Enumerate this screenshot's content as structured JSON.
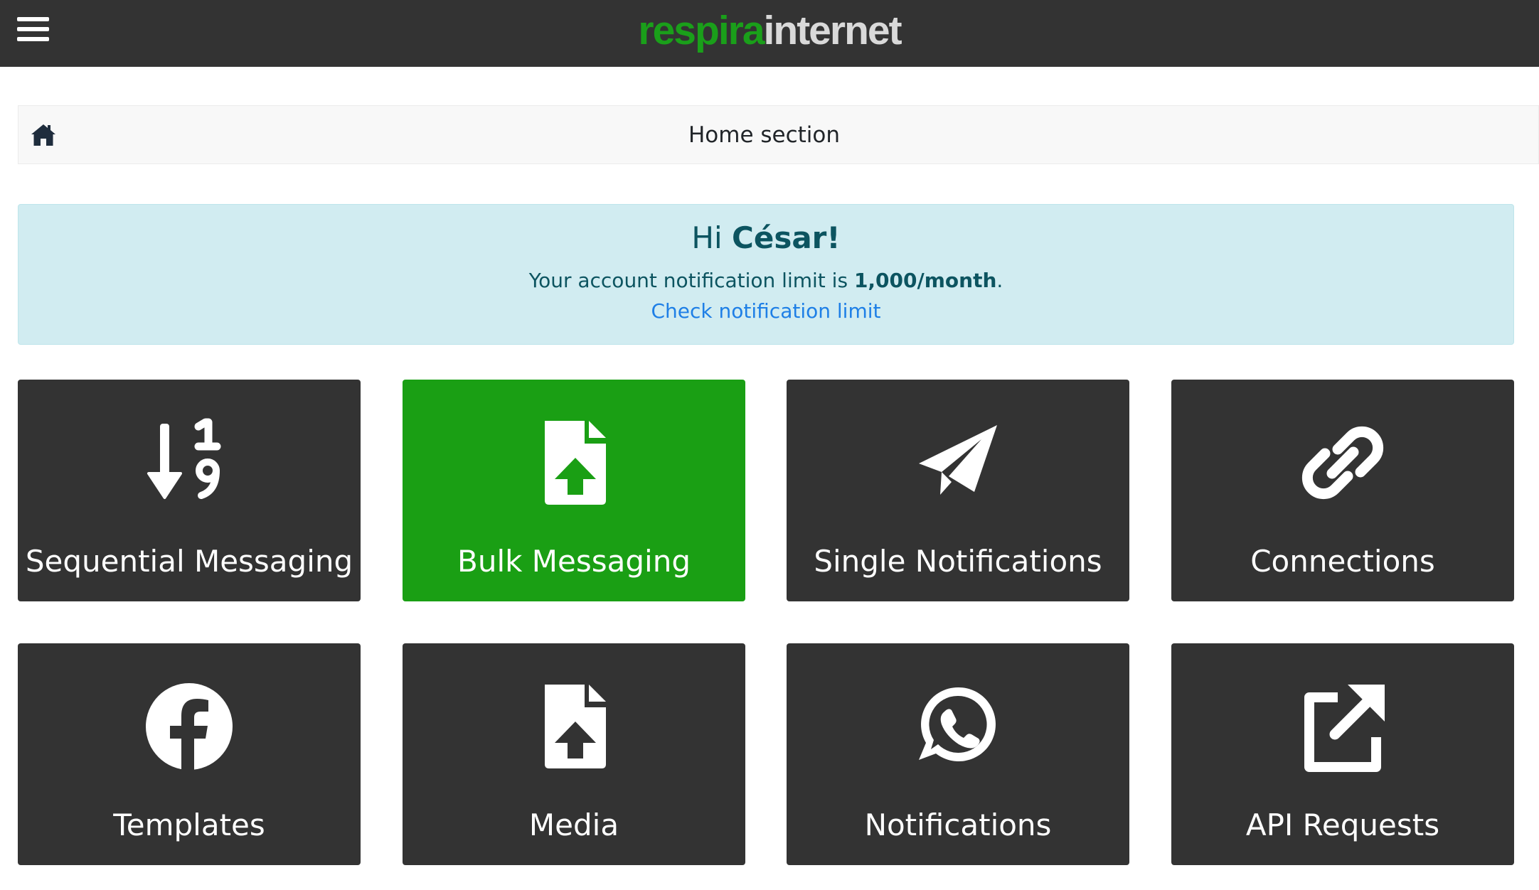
{
  "brand": {
    "name_part1": "respira",
    "name_part2": "internet",
    "colors": {
      "primary": "#1a9f14",
      "topbar": "#333333",
      "tile": "#333333",
      "alert_bg": "#d1ecf1",
      "link": "#1e7fe6"
    }
  },
  "header": {
    "menu_icon": "hamburger-icon"
  },
  "breadcrumb": {
    "home_icon": "home-icon",
    "title": "Home section"
  },
  "alert": {
    "greeting_prefix": "Hi ",
    "user_name": "César!",
    "limit_prefix": "Your account notification limit is ",
    "limit_value": "1,000/month",
    "limit_suffix": ".",
    "link_text": "Check notification limit"
  },
  "tiles": [
    {
      "label": "Sequential Messaging",
      "icon": "sort-numeric-down-icon",
      "active": false
    },
    {
      "label": "Bulk Messaging",
      "icon": "file-upload-icon",
      "active": true
    },
    {
      "label": "Single Notifications",
      "icon": "paper-plane-icon",
      "active": false
    },
    {
      "label": "Connections",
      "icon": "link-icon",
      "active": false
    },
    {
      "label": "Templates",
      "icon": "facebook-icon",
      "active": false
    },
    {
      "label": "Media",
      "icon": "file-upload-icon",
      "active": false
    },
    {
      "label": "Notifications",
      "icon": "whatsapp-icon",
      "active": false
    },
    {
      "label": "API Requests",
      "icon": "external-link-icon",
      "active": false
    }
  ]
}
